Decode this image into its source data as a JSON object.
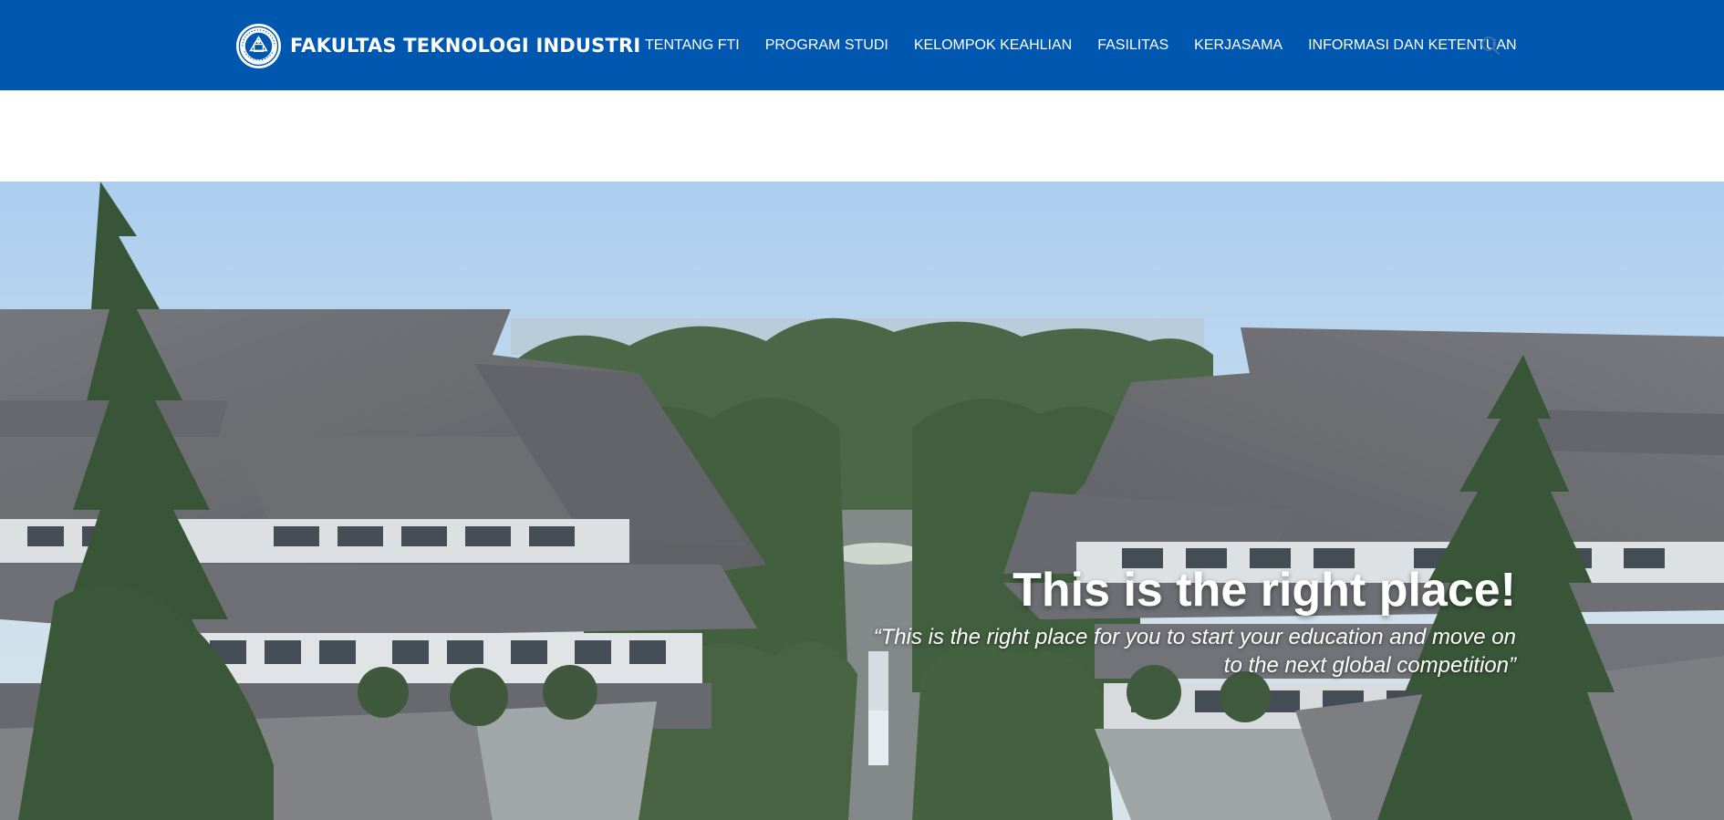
{
  "header": {
    "brand_name": "FAKULTAS TEKNOLOGI INDUSTRI",
    "background_color": "#0057b0",
    "logo_icon": "institution-seal-icon",
    "search_icon": "search-icon"
  },
  "nav": {
    "items": [
      {
        "label": "TENTANG FTI"
      },
      {
        "label": "PROGRAM STUDI"
      },
      {
        "label": "KELOMPOK KEAHLIAN"
      },
      {
        "label": "FASILITAS"
      },
      {
        "label": "KERJASAMA"
      },
      {
        "label": "INFORMASI DAN KETENTUAN"
      }
    ]
  },
  "hero": {
    "title": "This is the right place!",
    "subtitle_line1": "“This is the right place for you to start your education and move on",
    "subtitle_line2": "to the next global competition”"
  }
}
